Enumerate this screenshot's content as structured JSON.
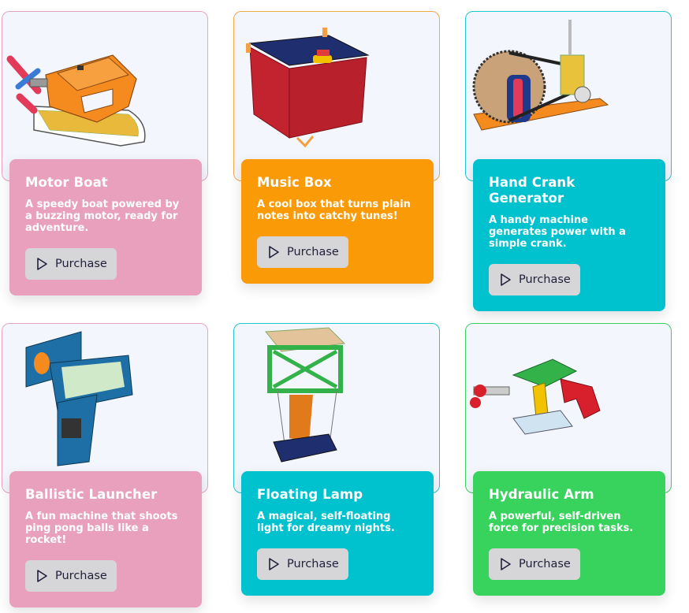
{
  "products": [
    {
      "title": "Motor Boat",
      "description": "A speedy boat powered by a buzzing motor, ready for adventure.",
      "button": "Purchase",
      "icon": "play-icon",
      "color": "#e8a0bc",
      "border": "#e6a3c2"
    },
    {
      "title": "Music Box",
      "description": "A cool box that turns plain notes into catchy tunes!",
      "button": "Purchase",
      "icon": "play-icon",
      "color": "#f99a06",
      "border": "#f0a94a"
    },
    {
      "title": "Hand Crank Generator",
      "description": "A handy machine generates power with a simple crank.",
      "button": "Purchase",
      "icon": "play-icon",
      "color": "#00c2cf",
      "border": "#24c5cf"
    },
    {
      "title": "Ballistic Launcher",
      "description": "A fun machine that shoots ping pong balls like a rocket!",
      "button": "Purchase",
      "icon": "play-icon",
      "color": "#e8a0bc",
      "border": "#e6a3c2"
    },
    {
      "title": "Floating Lamp",
      "description": "A magical, self-floating light for dreamy nights.",
      "button": "Purchase",
      "icon": "play-icon",
      "color": "#00c2cf",
      "border": "#24c5cf"
    },
    {
      "title": "Hydraulic Arm",
      "description": "A powerful, self-driven force for precision tasks.",
      "button": "Purchase",
      "icon": "play-icon",
      "color": "#37d35c",
      "border": "#3ecf62"
    }
  ]
}
